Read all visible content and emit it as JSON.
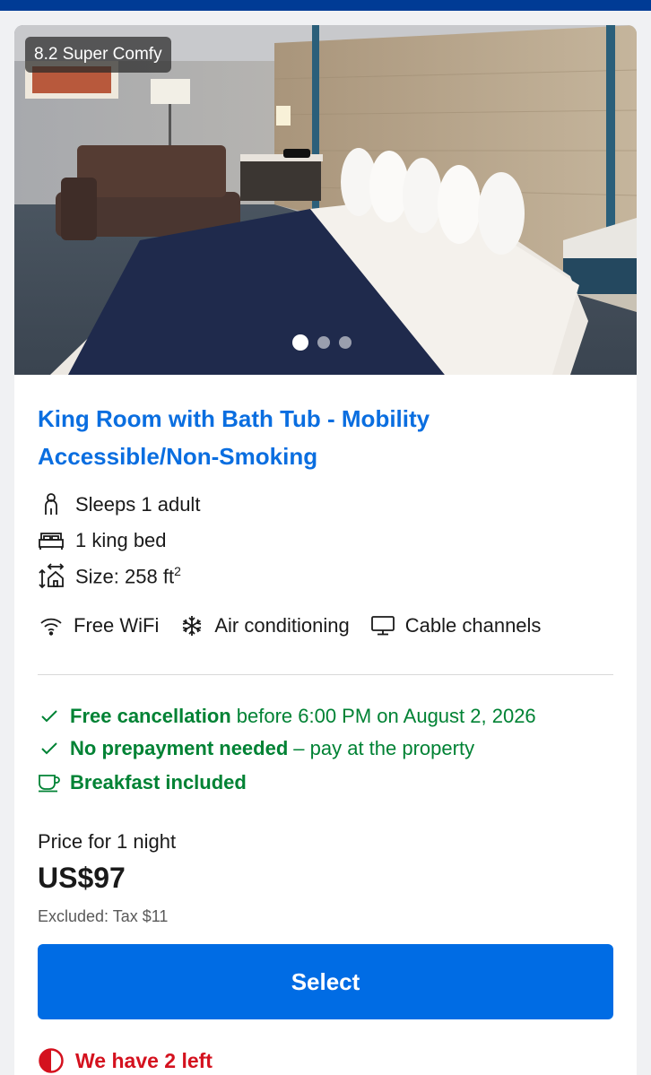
{
  "room": {
    "rating_badge": "8.2 Super Comfy",
    "photo_count": 3,
    "active_photo_index": 0,
    "title_line1": "King Room with Bath Tub - Mobility",
    "title_line2": "Accessible/Non-Smoking",
    "details": {
      "sleeps": "Sleeps 1 adult",
      "beds": "1 king bed",
      "size_prefix": "Size: 258 ft",
      "size_sup": "2"
    },
    "facilities": [
      {
        "icon": "wifi-icon",
        "label": "Free WiFi"
      },
      {
        "icon": "snowflake-icon",
        "label": "Air conditioning"
      },
      {
        "icon": "tv-icon",
        "label": "Cable channels"
      }
    ],
    "policies": {
      "cancellation_bold": "Free cancellation",
      "cancellation_rest": "before 6:00 PM on August 2, 2026",
      "prepayment_bold": "No prepayment needed",
      "prepayment_rest": "– pay at the property",
      "breakfast": "Breakfast included"
    },
    "price": {
      "label": "Price for 1 night",
      "amount": "US$97",
      "tax_note": "Excluded: Tax $11"
    },
    "select_label": "Select",
    "scarcity": "We have 2 left"
  },
  "colors": {
    "brand_dark": "#003b95",
    "link_blue": "#0a6ee0",
    "button_blue": "#006ce4",
    "green": "#008234",
    "red": "#d4111e"
  }
}
